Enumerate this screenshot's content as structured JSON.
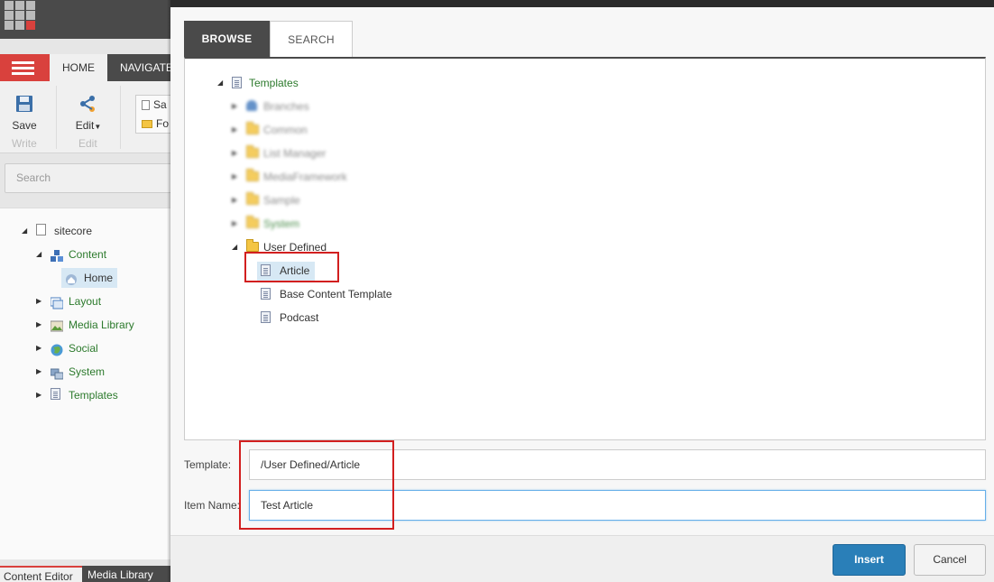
{
  "left_panel": {
    "ribbon": {
      "tab_home": "HOME",
      "tab_navigate": "NAVIGATE",
      "save_label": "Save",
      "write_label": "Write",
      "edit_label": "Edit",
      "edit_group_label": "Edit",
      "small_item_1": "Sa",
      "small_item_2": "Fo"
    },
    "search_placeholder": "Search",
    "tree": [
      {
        "label": "sitecore",
        "icon": "page-icon",
        "arrow": "expanded"
      },
      {
        "label": "Content",
        "icon": "content-cubes-icon",
        "arrow": "expanded"
      },
      {
        "label": "Home",
        "icon": "home-icon",
        "arrow": "none"
      },
      {
        "label": "Layout",
        "icon": "layout-icon",
        "arrow": "collapsed"
      },
      {
        "label": "Media Library",
        "icon": "media-library-icon",
        "arrow": "collapsed"
      },
      {
        "label": "Social",
        "icon": "social-globe-icon",
        "arrow": "collapsed"
      },
      {
        "label": "System",
        "icon": "system-icon",
        "arrow": "collapsed"
      },
      {
        "label": "Templates",
        "icon": "templates-icon",
        "arrow": "collapsed"
      }
    ],
    "bottom_tabs": {
      "content_editor": "Content Editor",
      "media_library": "Media Library"
    }
  },
  "dialog": {
    "tabs": {
      "browse": "BROWSE",
      "search": "SEARCH"
    },
    "tree": {
      "root": "Templates",
      "blurred_children": [
        "Branches",
        "Common",
        "List Manager",
        "MediaFramework",
        "Sample",
        "System"
      ],
      "user_defined": "User Defined",
      "children": [
        "Article",
        "Base Content Template",
        "Podcast"
      ],
      "selected": "Article"
    },
    "template_label": "Template:",
    "template_value": "/User Defined/Article",
    "item_name_label": "Item Name:",
    "item_name_value": "Test Article",
    "insert_button": "Insert",
    "cancel_button": "Cancel",
    "colors": {
      "primary_button": "#2a7fb8",
      "highlight_box": "#d21f1f",
      "tree_label_green": "#2c7a2c",
      "brand_red": "#d9413d"
    }
  }
}
